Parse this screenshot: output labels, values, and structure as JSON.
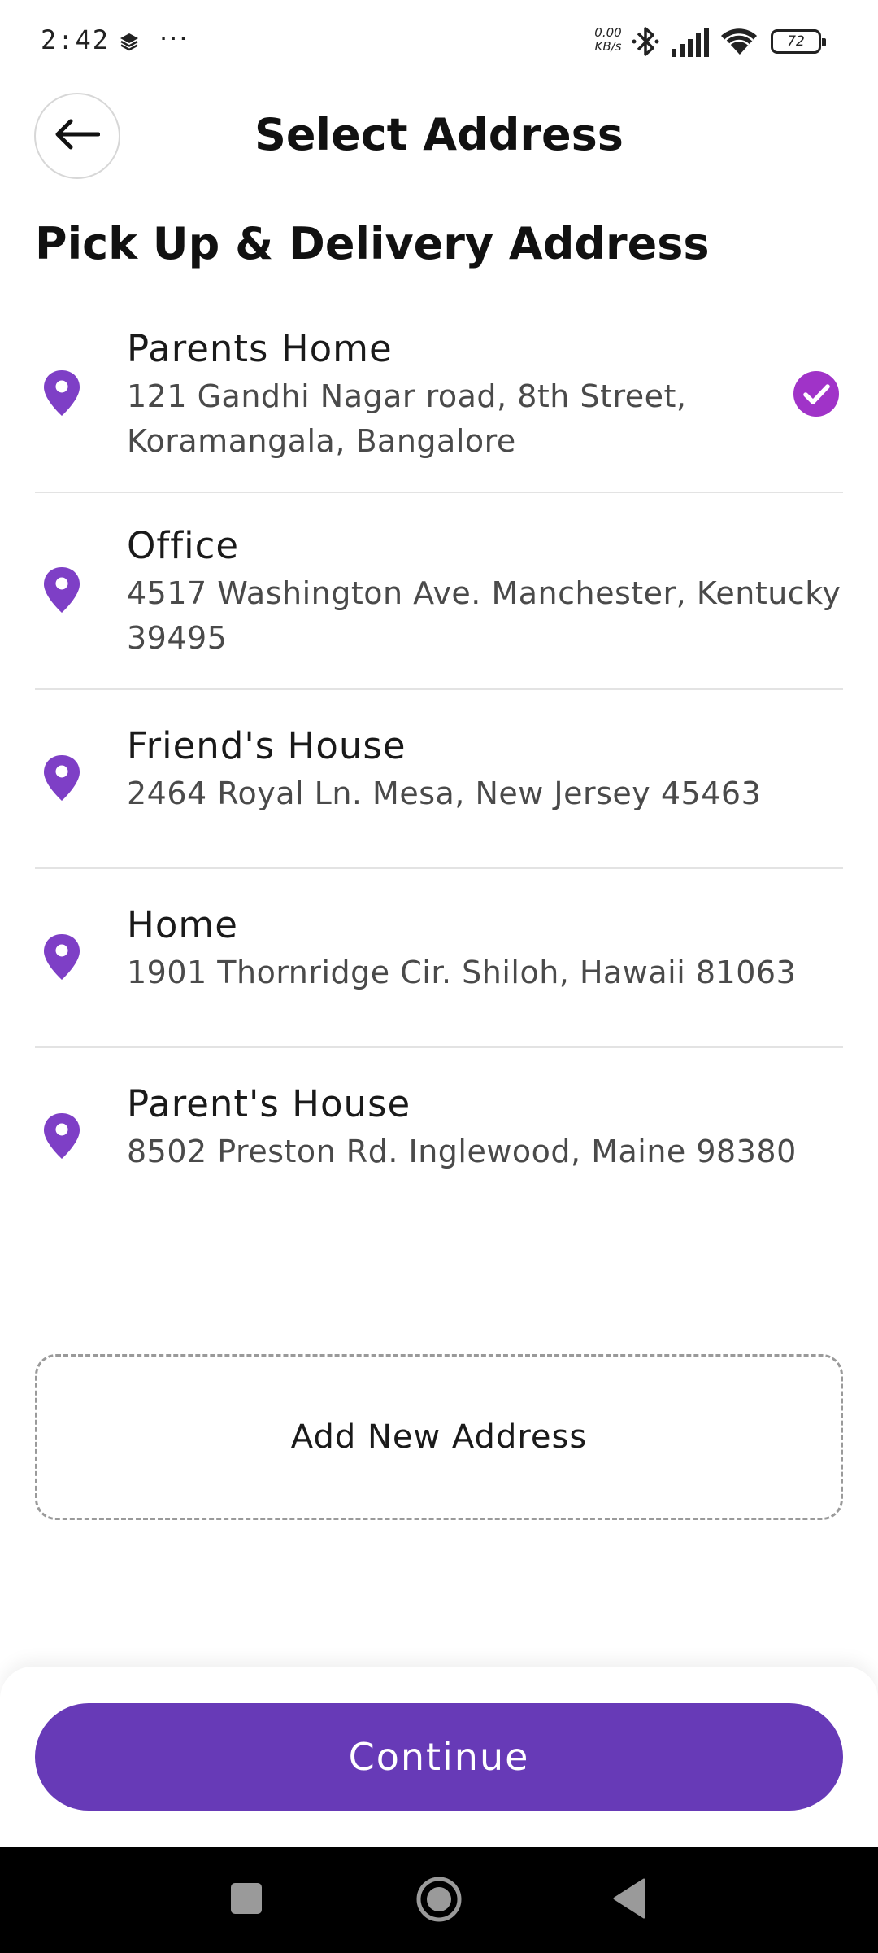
{
  "status_bar": {
    "time": "2:42",
    "dots": "···",
    "net_speed_value": "0.00",
    "net_speed_unit": "KB/s",
    "battery": "72"
  },
  "header": {
    "title": "Select Address"
  },
  "section": {
    "title": "Pick Up & Delivery Address"
  },
  "addresses": [
    {
      "label": "Parents Home",
      "address": "121 Gandhi Nagar road, 8th Street, Koramangala, Bangalore",
      "selected": true
    },
    {
      "label": "Office",
      "address": "4517 Washington Ave. Manchester, Kentucky 39495",
      "selected": false
    },
    {
      "label": "Friend's House",
      "address": "2464 Royal Ln. Mesa, New Jersey 45463",
      "selected": false
    },
    {
      "label": "Home",
      "address": "1901 Thornridge Cir. Shiloh, Hawaii 81063",
      "selected": false
    },
    {
      "label": "Parent's House",
      "address": "8502 Preston Rd. Inglewood, Maine 98380",
      "selected": false
    }
  ],
  "add_address_label": "Add New Address",
  "continue_label": "Continue",
  "colors": {
    "accent": "#673AB7",
    "pin": "#7E3FC6",
    "divider": "#E3E3E3"
  },
  "icons": {
    "back": "arrow-left-icon",
    "pin": "location-pin-icon",
    "selected": "check-circle-icon"
  }
}
